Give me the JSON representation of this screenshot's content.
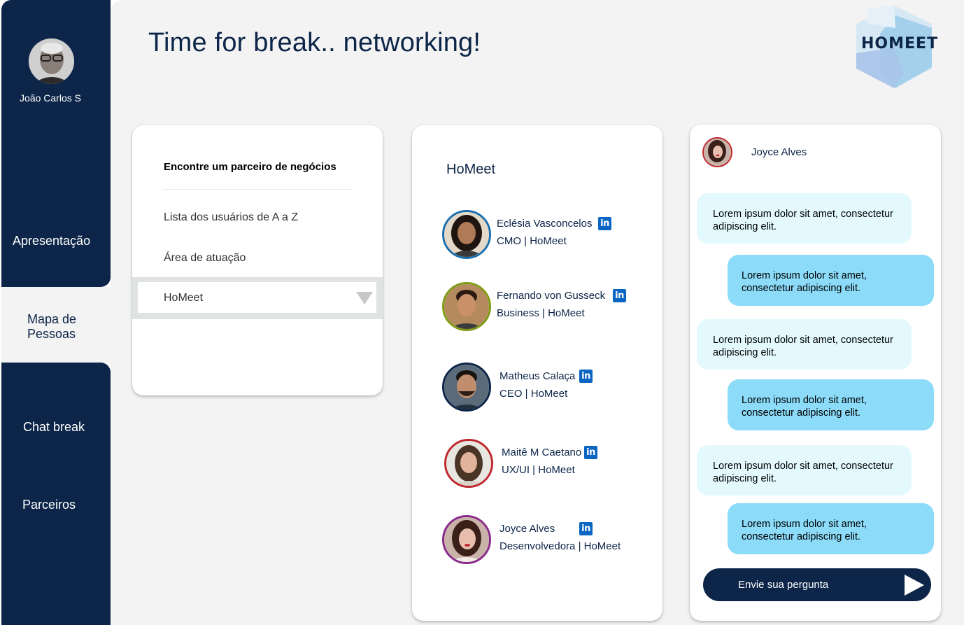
{
  "user": {
    "name": "João Carlos S"
  },
  "nav": {
    "items": [
      {
        "label": "Apresentação"
      },
      {
        "label": "Mapa de Pessoas"
      },
      {
        "label": "Chat break"
      },
      {
        "label": "Parceiros"
      }
    ],
    "active_label_line1": "Mapa de",
    "active_label_line2": "Pessoas"
  },
  "header": {
    "title": "Time for break.. networking!",
    "logo_text": "HOMEET"
  },
  "filter": {
    "title": "Encontre um parceiro de negócios",
    "options": [
      "Lista dos usuários de A a Z",
      "Área de atuação"
    ],
    "selected": "HoMeet"
  },
  "people": {
    "title": "HoMeet",
    "list": [
      {
        "name": "Eclésia Vasconcelos",
        "role": "CMO | HoMeet",
        "ring": "#1b6fae"
      },
      {
        "name": "Fernando von Gusseck",
        "role": "Business | HoMeet",
        "ring": "#7f9a14"
      },
      {
        "name": "Matheus Calaça",
        "role": "CEO | HoMeet",
        "ring": "#0c2548"
      },
      {
        "name": "Maitê M Caetano",
        "role": "UX/UI | HoMeet",
        "ring": "#c0282d"
      },
      {
        "name": "Joyce Alves",
        "role": "Desenvolvedora | HoMeet",
        "ring": "#8a2a8a"
      }
    ],
    "linkedin_label": "in"
  },
  "chat": {
    "contact_name": "Joyce Alves",
    "messages": [
      {
        "dir": "in",
        "text": "Lorem ipsum dolor sit amet, consectetur adipiscing elit."
      },
      {
        "dir": "out",
        "text": "Lorem ipsum dolor sit amet, consectetur adipiscing elit."
      },
      {
        "dir": "in",
        "text": "Lorem ipsum dolor sit amet, consectetur adipiscing elit."
      },
      {
        "dir": "out",
        "text": "Lorem ipsum dolor sit amet, consectetur adipiscing elit."
      },
      {
        "dir": "in",
        "text": "Lorem ipsum dolor sit amet, consectetur adipiscing elit."
      },
      {
        "dir": "out",
        "text": "Lorem ipsum dolor sit amet, consectetur adipiscing elit."
      }
    ],
    "input_placeholder": "Envie sua pergunta"
  },
  "colors": {
    "navy": "#0c2548",
    "bubble_in": "#e3f9fd",
    "bubble_out": "#8bdbf9",
    "linkedin": "#0a66c2"
  }
}
